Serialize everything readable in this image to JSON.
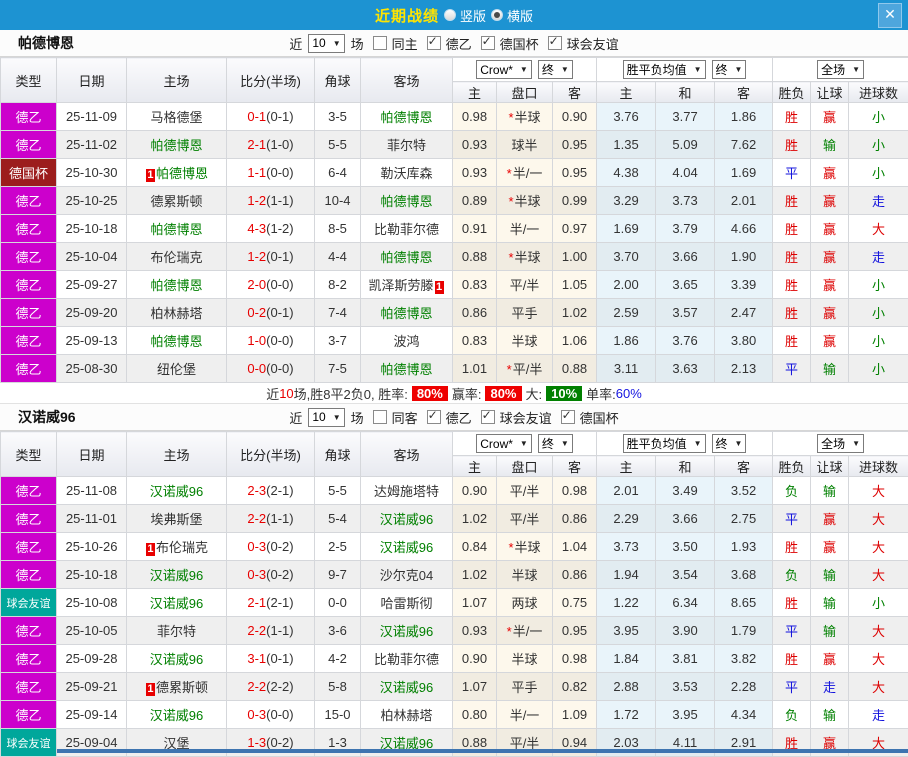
{
  "titlebar": {
    "title": "近期战绩",
    "radios": [
      {
        "label": "竖版",
        "selected": false
      },
      {
        "label": "横版",
        "selected": true
      }
    ],
    "close_label": "✕"
  },
  "table": {
    "left_columns": [
      "类型",
      "日期",
      "主场",
      "比分(半场)",
      "角球",
      "客场"
    ],
    "group_columns": [
      [
        "主",
        "盘口",
        "客"
      ],
      [
        "主",
        "和",
        "客"
      ],
      [
        "胜负",
        "让球",
        "进球数"
      ]
    ],
    "dropdowns": {
      "company": "Crow*",
      "final_a": "终",
      "avg": "胜平负均值",
      "final_b": "终",
      "scope": "全场"
    }
  },
  "type_colors": {
    "德乙": "#cc00cc",
    "德国杯": "#9c1d1d",
    "球会友谊": "#00a79b"
  },
  "result_colors": {
    "r": "#dd0000",
    "b": "#1212dd",
    "g": "#008000"
  },
  "accent": {
    "topbar": "#1d93d2",
    "title": "#ffe400",
    "score": "#e80000"
  },
  "sections": [
    {
      "team": "帕德博恩",
      "filter": {
        "near": "近",
        "count": "10",
        "unit": "场",
        "same": {
          "label": "同主",
          "checked": false
        },
        "comps": [
          {
            "label": "德乙",
            "checked": true
          },
          {
            "label": "德国杯",
            "checked": true
          },
          {
            "label": "球会友谊",
            "checked": true
          }
        ]
      },
      "rows": [
        {
          "lg": "德乙",
          "date": "25-11-09",
          "home": "马格德堡",
          "home_focus": false,
          "home_card": null,
          "score": "0-1",
          "half": "(0-1)",
          "corners": "3-5",
          "away": "帕德博恩",
          "away_focus": true,
          "away_card": null,
          "w1": "0.98",
          "star": true,
          "hcp": "半球",
          "w2": "0.90",
          "e1": "3.76",
          "e2": "3.77",
          "e3": "1.86",
          "res": [
            [
              "胜",
              "r"
            ],
            [
              "赢",
              "r"
            ],
            [
              "小",
              "g"
            ]
          ]
        },
        {
          "lg": "德乙",
          "date": "25-11-02",
          "home": "帕德博恩",
          "home_focus": true,
          "home_card": null,
          "score": "2-1",
          "half": "(1-0)",
          "corners": "5-5",
          "away": "菲尔特",
          "away_focus": false,
          "away_card": null,
          "w1": "0.93",
          "star": false,
          "hcp": "球半",
          "w2": "0.95",
          "e1": "1.35",
          "e2": "5.09",
          "e3": "7.62",
          "res": [
            [
              "胜",
              "r"
            ],
            [
              "输",
              "g"
            ],
            [
              "小",
              "g"
            ]
          ]
        },
        {
          "lg": "德国杯",
          "date": "25-10-30",
          "home": "帕德博恩",
          "home_focus": true,
          "home_card": "before",
          "score": "1-1",
          "half": "(0-0)",
          "corners": "6-4",
          "away": "勒沃库森",
          "away_focus": false,
          "away_card": null,
          "w1": "0.93",
          "star": true,
          "hcp": "半/一",
          "w2": "0.95",
          "e1": "4.38",
          "e2": "4.04",
          "e3": "1.69",
          "res": [
            [
              "平",
              "b"
            ],
            [
              "赢",
              "r"
            ],
            [
              "小",
              "g"
            ]
          ]
        },
        {
          "lg": "德乙",
          "date": "25-10-25",
          "home": "德累斯顿",
          "home_focus": false,
          "home_card": null,
          "score": "1-2",
          "half": "(1-1)",
          "corners": "10-4",
          "away": "帕德博恩",
          "away_focus": true,
          "away_card": null,
          "w1": "0.89",
          "star": true,
          "hcp": "半球",
          "w2": "0.99",
          "e1": "3.29",
          "e2": "3.73",
          "e3": "2.01",
          "res": [
            [
              "胜",
              "r"
            ],
            [
              "赢",
              "r"
            ],
            [
              "走",
              "b"
            ]
          ]
        },
        {
          "lg": "德乙",
          "date": "25-10-18",
          "home": "帕德博恩",
          "home_focus": true,
          "home_card": null,
          "score": "4-3",
          "half": "(1-2)",
          "corners": "8-5",
          "away": "比勒菲尔德",
          "away_focus": false,
          "away_card": null,
          "w1": "0.91",
          "star": false,
          "hcp": "半/一",
          "w2": "0.97",
          "e1": "1.69",
          "e2": "3.79",
          "e3": "4.66",
          "res": [
            [
              "胜",
              "r"
            ],
            [
              "赢",
              "r"
            ],
            [
              "大",
              "r"
            ]
          ]
        },
        {
          "lg": "德乙",
          "date": "25-10-04",
          "home": "布伦瑞克",
          "home_focus": false,
          "home_card": null,
          "score": "1-2",
          "half": "(0-1)",
          "corners": "4-4",
          "away": "帕德博恩",
          "away_focus": true,
          "away_card": null,
          "w1": "0.88",
          "star": true,
          "hcp": "半球",
          "w2": "1.00",
          "e1": "3.70",
          "e2": "3.66",
          "e3": "1.90",
          "res": [
            [
              "胜",
              "r"
            ],
            [
              "赢",
              "r"
            ],
            [
              "走",
              "b"
            ]
          ]
        },
        {
          "lg": "德乙",
          "date": "25-09-27",
          "home": "帕德博恩",
          "home_focus": true,
          "home_card": null,
          "score": "2-0",
          "half": "(0-0)",
          "corners": "8-2",
          "away": "凯泽斯劳滕",
          "away_focus": false,
          "away_card": "after",
          "w1": "0.83",
          "star": false,
          "hcp": "平/半",
          "w2": "1.05",
          "e1": "2.00",
          "e2": "3.65",
          "e3": "3.39",
          "res": [
            [
              "胜",
              "r"
            ],
            [
              "赢",
              "r"
            ],
            [
              "小",
              "g"
            ]
          ]
        },
        {
          "lg": "德乙",
          "date": "25-09-20",
          "home": "柏林赫塔",
          "home_focus": false,
          "home_card": null,
          "score": "0-2",
          "half": "(0-1)",
          "corners": "7-4",
          "away": "帕德博恩",
          "away_focus": true,
          "away_card": null,
          "w1": "0.86",
          "star": false,
          "hcp": "平手",
          "w2": "1.02",
          "e1": "2.59",
          "e2": "3.57",
          "e3": "2.47",
          "res": [
            [
              "胜",
              "r"
            ],
            [
              "赢",
              "r"
            ],
            [
              "小",
              "g"
            ]
          ]
        },
        {
          "lg": "德乙",
          "date": "25-09-13",
          "home": "帕德博恩",
          "home_focus": true,
          "home_card": null,
          "score": "1-0",
          "half": "(0-0)",
          "corners": "3-7",
          "away": "波鸿",
          "away_focus": false,
          "away_card": null,
          "w1": "0.83",
          "star": false,
          "hcp": "半球",
          "w2": "1.06",
          "e1": "1.86",
          "e2": "3.76",
          "e3": "3.80",
          "res": [
            [
              "胜",
              "r"
            ],
            [
              "赢",
              "r"
            ],
            [
              "小",
              "g"
            ]
          ]
        },
        {
          "lg": "德乙",
          "date": "25-08-30",
          "home": "纽伦堡",
          "home_focus": false,
          "home_card": null,
          "score": "0-0",
          "half": "(0-0)",
          "corners": "7-5",
          "away": "帕德博恩",
          "away_focus": true,
          "away_card": null,
          "w1": "1.01",
          "star": true,
          "hcp": "平/半",
          "w2": "0.88",
          "e1": "3.11",
          "e2": "3.63",
          "e3": "2.13",
          "res": [
            [
              "平",
              "b"
            ],
            [
              "输",
              "g"
            ],
            [
              "小",
              "g"
            ]
          ]
        }
      ],
      "summary": {
        "parts": [
          {
            "t": "近",
            "c": "#333"
          },
          {
            "t": "10",
            "c": "#e80000"
          },
          {
            "t": "场,胜8平2负0, 胜率:",
            "c": "#333"
          },
          {
            "t": "80%",
            "bg": "#ee0000"
          },
          {
            "t": "赢率:",
            "c": "#333"
          },
          {
            "t": "80%",
            "bg": "#ee0000"
          },
          {
            "t": "大:",
            "c": "#333"
          },
          {
            "t": "10%",
            "bg": "#008000"
          },
          {
            "t": "单率:",
            "c": "#333"
          },
          {
            "t": "60%",
            "c": "#1515e0"
          }
        ]
      }
    },
    {
      "team": "汉诺威96",
      "filter": {
        "near": "近",
        "count": "10",
        "unit": "场",
        "same": {
          "label": "同客",
          "checked": false
        },
        "comps": [
          {
            "label": "德乙",
            "checked": true
          },
          {
            "label": "球会友谊",
            "checked": true
          },
          {
            "label": "德国杯",
            "checked": true
          }
        ]
      },
      "rows": [
        {
          "lg": "德乙",
          "date": "25-11-08",
          "home": "汉诺威96",
          "home_focus": true,
          "home_card": null,
          "score": "2-3",
          "half": "(2-1)",
          "corners": "5-5",
          "away": "达姆施塔特",
          "away_focus": false,
          "away_card": null,
          "w1": "0.90",
          "star": false,
          "hcp": "平/半",
          "w2": "0.98",
          "e1": "2.01",
          "e2": "3.49",
          "e3": "3.52",
          "res": [
            [
              "负",
              "g"
            ],
            [
              "输",
              "g"
            ],
            [
              "大",
              "r"
            ]
          ]
        },
        {
          "lg": "德乙",
          "date": "25-11-01",
          "home": "埃弗斯堡",
          "home_focus": false,
          "home_card": null,
          "score": "2-2",
          "half": "(1-1)",
          "corners": "5-4",
          "away": "汉诺威96",
          "away_focus": true,
          "away_card": null,
          "w1": "1.02",
          "star": false,
          "hcp": "平/半",
          "w2": "0.86",
          "e1": "2.29",
          "e2": "3.66",
          "e3": "2.75",
          "res": [
            [
              "平",
              "b"
            ],
            [
              "赢",
              "r"
            ],
            [
              "大",
              "r"
            ]
          ]
        },
        {
          "lg": "德乙",
          "date": "25-10-26",
          "home": "布伦瑞克",
          "home_focus": false,
          "home_card": "before",
          "score": "0-3",
          "half": "(0-2)",
          "corners": "2-5",
          "away": "汉诺威96",
          "away_focus": true,
          "away_card": null,
          "w1": "0.84",
          "star": true,
          "hcp": "半球",
          "w2": "1.04",
          "e1": "3.73",
          "e2": "3.50",
          "e3": "1.93",
          "res": [
            [
              "胜",
              "r"
            ],
            [
              "赢",
              "r"
            ],
            [
              "大",
              "r"
            ]
          ]
        },
        {
          "lg": "德乙",
          "date": "25-10-18",
          "home": "汉诺威96",
          "home_focus": true,
          "home_card": null,
          "score": "0-3",
          "half": "(0-2)",
          "corners": "9-7",
          "away": "沙尔克04",
          "away_focus": false,
          "away_card": null,
          "w1": "1.02",
          "star": false,
          "hcp": "半球",
          "w2": "0.86",
          "e1": "1.94",
          "e2": "3.54",
          "e3": "3.68",
          "res": [
            [
              "负",
              "g"
            ],
            [
              "输",
              "g"
            ],
            [
              "大",
              "r"
            ]
          ]
        },
        {
          "lg": "球会友谊",
          "date": "25-10-08",
          "home": "汉诺威96",
          "home_focus": true,
          "home_card": null,
          "score": "2-1",
          "half": "(2-1)",
          "corners": "0-0",
          "away": "哈雷斯彻",
          "away_focus": false,
          "away_card": null,
          "w1": "1.07",
          "star": false,
          "hcp": "两球",
          "w2": "0.75",
          "e1": "1.22",
          "e2": "6.34",
          "e3": "8.65",
          "res": [
            [
              "胜",
              "r"
            ],
            [
              "输",
              "g"
            ],
            [
              "小",
              "g"
            ]
          ]
        },
        {
          "lg": "德乙",
          "date": "25-10-05",
          "home": "菲尔特",
          "home_focus": false,
          "home_card": null,
          "score": "2-2",
          "half": "(1-1)",
          "corners": "3-6",
          "away": "汉诺威96",
          "away_focus": true,
          "away_card": null,
          "w1": "0.93",
          "star": true,
          "hcp": "半/一",
          "w2": "0.95",
          "e1": "3.95",
          "e2": "3.90",
          "e3": "1.79",
          "res": [
            [
              "平",
              "b"
            ],
            [
              "输",
              "g"
            ],
            [
              "大",
              "r"
            ]
          ]
        },
        {
          "lg": "德乙",
          "date": "25-09-28",
          "home": "汉诺威96",
          "home_focus": true,
          "home_card": null,
          "score": "3-1",
          "half": "(0-1)",
          "corners": "4-2",
          "away": "比勒菲尔德",
          "away_focus": false,
          "away_card": null,
          "w1": "0.90",
          "star": false,
          "hcp": "半球",
          "w2": "0.98",
          "e1": "1.84",
          "e2": "3.81",
          "e3": "3.82",
          "res": [
            [
              "胜",
              "r"
            ],
            [
              "赢",
              "r"
            ],
            [
              "大",
              "r"
            ]
          ]
        },
        {
          "lg": "德乙",
          "date": "25-09-21",
          "home": "德累斯顿",
          "home_focus": false,
          "home_card": "before",
          "score": "2-2",
          "half": "(2-2)",
          "corners": "5-8",
          "away": "汉诺威96",
          "away_focus": true,
          "away_card": null,
          "w1": "1.07",
          "star": false,
          "hcp": "平手",
          "w2": "0.82",
          "e1": "2.88",
          "e2": "3.53",
          "e3": "2.28",
          "res": [
            [
              "平",
              "b"
            ],
            [
              "走",
              "b"
            ],
            [
              "大",
              "r"
            ]
          ]
        },
        {
          "lg": "德乙",
          "date": "25-09-14",
          "home": "汉诺威96",
          "home_focus": true,
          "home_card": null,
          "score": "0-3",
          "half": "(0-0)",
          "corners": "15-0",
          "away": "柏林赫塔",
          "away_focus": false,
          "away_card": null,
          "w1": "0.80",
          "star": false,
          "hcp": "半/一",
          "w2": "1.09",
          "e1": "1.72",
          "e2": "3.95",
          "e3": "4.34",
          "res": [
            [
              "负",
              "g"
            ],
            [
              "输",
              "g"
            ],
            [
              "走",
              "b"
            ]
          ]
        },
        {
          "lg": "球会友谊",
          "date": "25-09-04",
          "home": "汉堡",
          "home_focus": false,
          "home_card": null,
          "score": "1-3",
          "half": "(0-2)",
          "corners": "1-3",
          "away": "汉诺威96",
          "away_focus": true,
          "away_card": null,
          "w1": "0.88",
          "star": false,
          "hcp": "平/半",
          "w2": "0.94",
          "e1": "2.03",
          "e2": "4.11",
          "e3": "2.91",
          "res": [
            [
              "胜",
              "r"
            ],
            [
              "赢",
              "r"
            ],
            [
              "大",
              "r"
            ]
          ]
        }
      ],
      "summary": null
    }
  ]
}
